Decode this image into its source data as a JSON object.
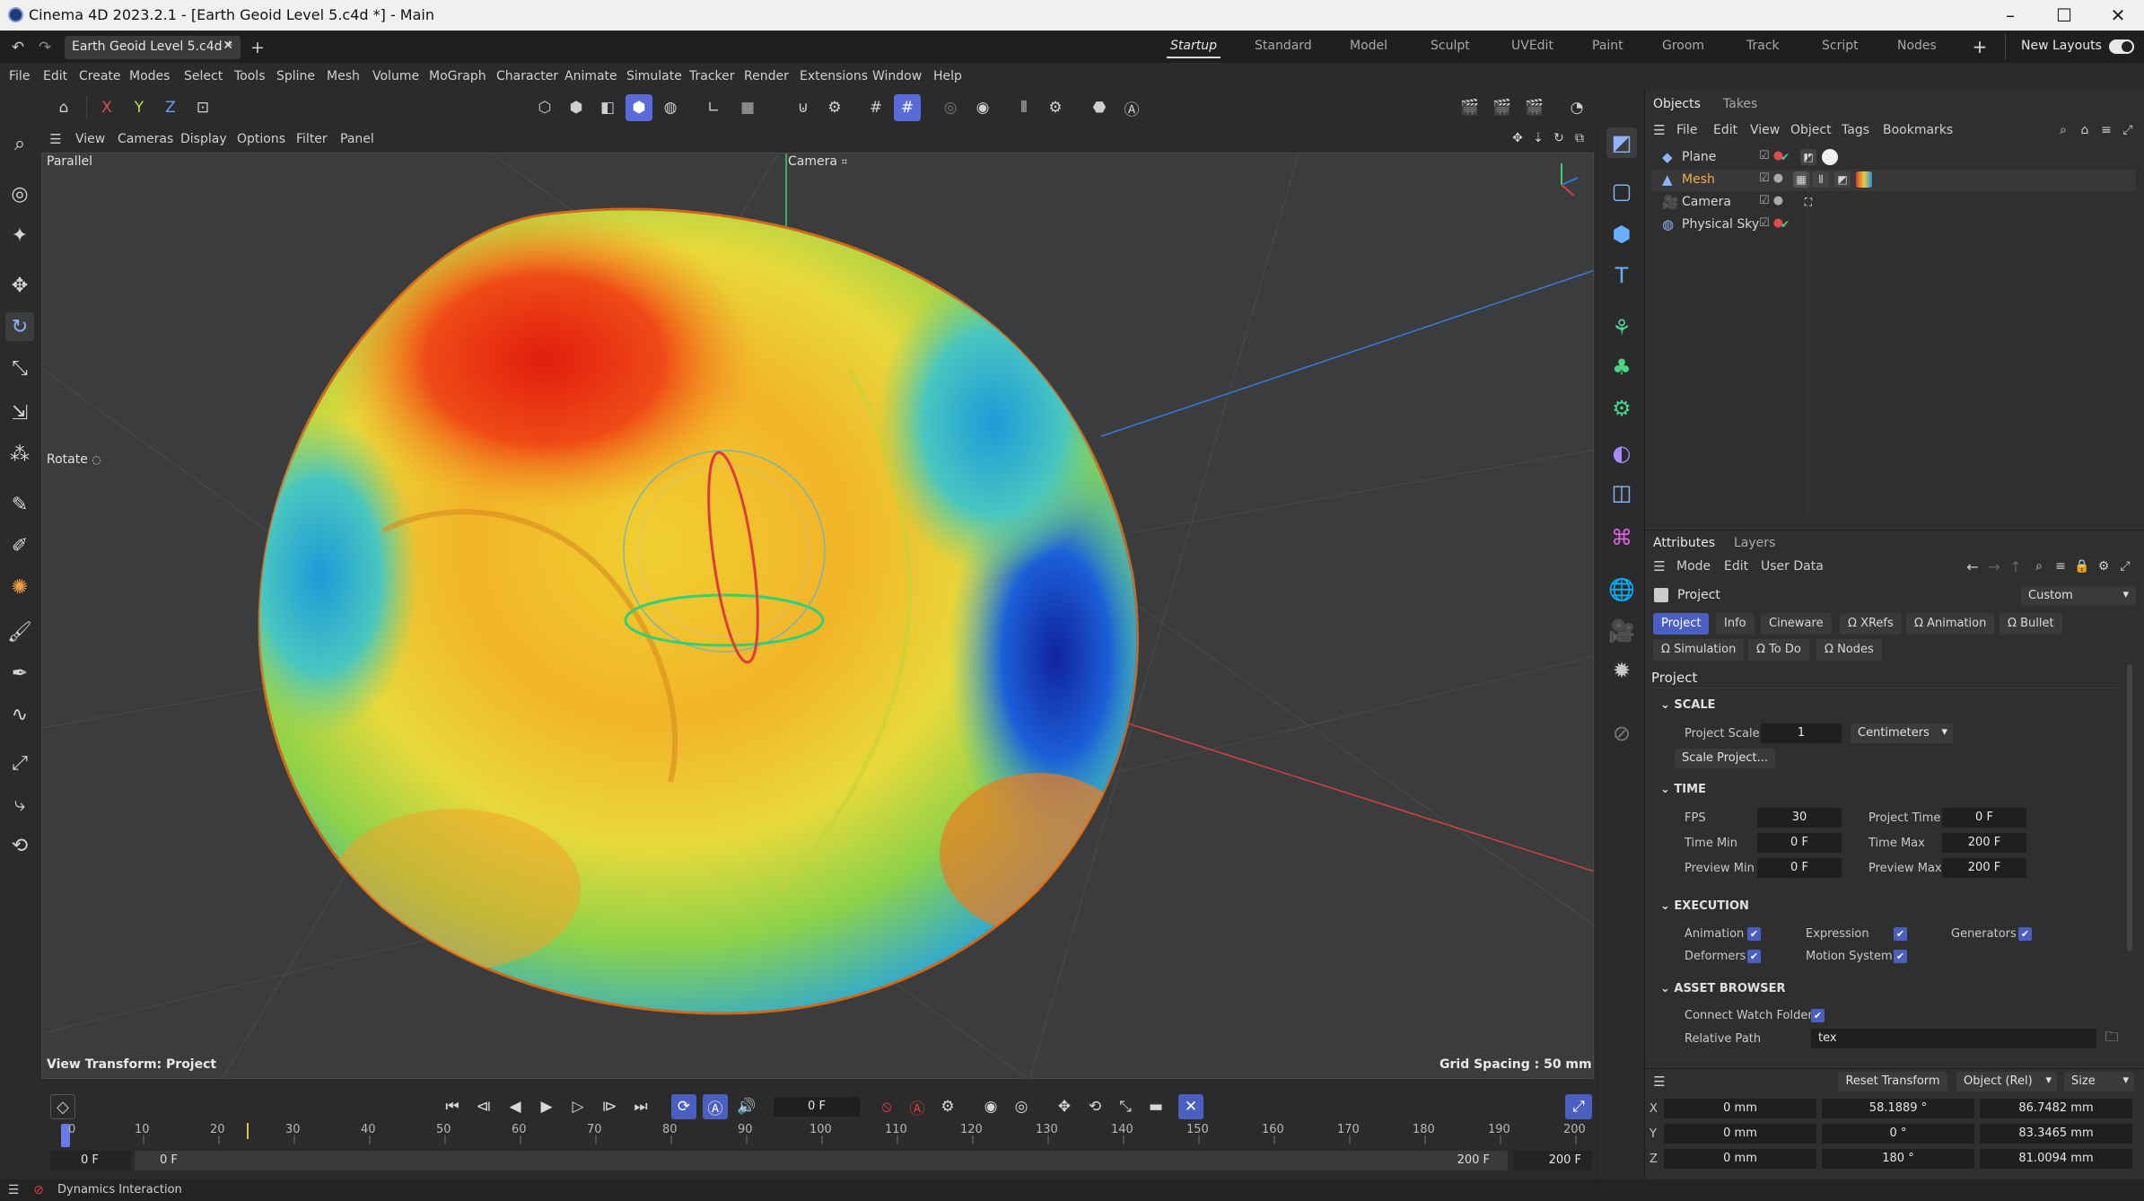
{
  "window": {
    "title": "Cinema 4D 2023.2.1 - [Earth Geoid Level 5.c4d *] - Main"
  },
  "document_tab": {
    "label": "Earth Geoid Level 5.c4d *"
  },
  "layouts": {
    "items": [
      "Startup",
      "Standard",
      "Model",
      "Sculpt",
      "UVEdit",
      "Paint",
      "Groom",
      "Track",
      "Script",
      "Nodes"
    ],
    "active": "Startup",
    "new_layouts": "New Layouts"
  },
  "menu": [
    "File",
    "Edit",
    "Create",
    "Modes",
    "Select",
    "Tools",
    "Spline",
    "Mesh",
    "Volume",
    "MoGraph",
    "Character",
    "Animate",
    "Simulate",
    "Tracker",
    "Render",
    "Extensions",
    "Window",
    "Help"
  ],
  "axis_toggles": [
    "X",
    "Y",
    "Z"
  ],
  "viewport": {
    "menu": [
      "View",
      "Cameras",
      "Display",
      "Options",
      "Filter",
      "Panel"
    ],
    "projection": "Parallel",
    "camera": "Camera",
    "tool": "Rotate",
    "view_transform": "View Transform: Project",
    "grid_spacing": "Grid Spacing : 50 mm"
  },
  "objects_panel": {
    "tabs": [
      "Objects",
      "Takes"
    ],
    "menu": [
      "File",
      "Edit",
      "View",
      "Object",
      "Tags",
      "Bookmarks"
    ],
    "objects": [
      {
        "name": "Plane",
        "icon": "plane-icon"
      },
      {
        "name": "Mesh",
        "icon": "mesh-icon"
      },
      {
        "name": "Camera",
        "icon": "camera-icon"
      },
      {
        "name": "Physical Sky",
        "icon": "sky-icon"
      }
    ]
  },
  "attributes": {
    "tabs": [
      "Attributes",
      "Layers"
    ],
    "menu": [
      "Mode",
      "Edit",
      "User Data"
    ],
    "object": "Project",
    "preset": "Custom",
    "section_tabs_row1": [
      "Project",
      "Info",
      "Cineware",
      "XRefs",
      "Animation",
      "Bullet"
    ],
    "section_tabs_row2": [
      "Simulation",
      "To Do",
      "Nodes"
    ],
    "heading": "Project",
    "scale": {
      "title": "SCALE",
      "project_scale_label": "Project Scale",
      "project_scale": "1",
      "unit": "Centimeters",
      "scale_button": "Scale Project..."
    },
    "time": {
      "title": "TIME",
      "fps_label": "FPS",
      "fps": "30",
      "project_time_label": "Project Time",
      "project_time": "0 F",
      "time_min_label": "Time Min",
      "time_min": "0 F",
      "time_max_label": "Time Max",
      "time_max": "200 F",
      "preview_min_label": "Preview Min",
      "preview_min": "0 F",
      "preview_max_label": "Preview Max",
      "preview_max": "200 F"
    },
    "execution": {
      "title": "EXECUTION",
      "items": [
        {
          "label": "Animation",
          "checked": true
        },
        {
          "label": "Expression",
          "checked": true
        },
        {
          "label": "Generators",
          "checked": true
        },
        {
          "label": "Deformers",
          "checked": true
        },
        {
          "label": "Motion System",
          "checked": true
        }
      ]
    },
    "asset_browser": {
      "title": "ASSET BROWSER",
      "watch_label": "Connect Watch Folder",
      "watch_checked": true,
      "path_label": "Relative Path",
      "path": "tex"
    }
  },
  "coordinates": {
    "reset_button": "Reset Transform",
    "mode": "Object (Rel)",
    "size_mode": "Size",
    "rows": [
      {
        "axis": "X",
        "pos": "0 mm",
        "rot": "58.1889 °",
        "size": "86.7482 mm"
      },
      {
        "axis": "Y",
        "pos": "0 mm",
        "rot": "0 °",
        "size": "83.3465 mm"
      },
      {
        "axis": "Z",
        "pos": "0 mm",
        "rot": "180 °",
        "size": "81.0094 mm"
      }
    ]
  },
  "timeline": {
    "current_frame": "0 F",
    "ticks": [
      "0",
      "10",
      "20",
      "30",
      "40",
      "50",
      "60",
      "70",
      "80",
      "90",
      "100",
      "110",
      "120",
      "130",
      "140",
      "150",
      "160",
      "170",
      "180",
      "190",
      "200"
    ],
    "range_start": "0 F",
    "range_start_preview": "0 F",
    "range_end_preview": "200 F",
    "range_end": "200 F"
  },
  "status": {
    "text": "Dynamics Interaction"
  },
  "colors": {
    "accent": "#4a5fbf",
    "toolbar_active": "#5a6ad8",
    "record": "#e23b3b"
  }
}
